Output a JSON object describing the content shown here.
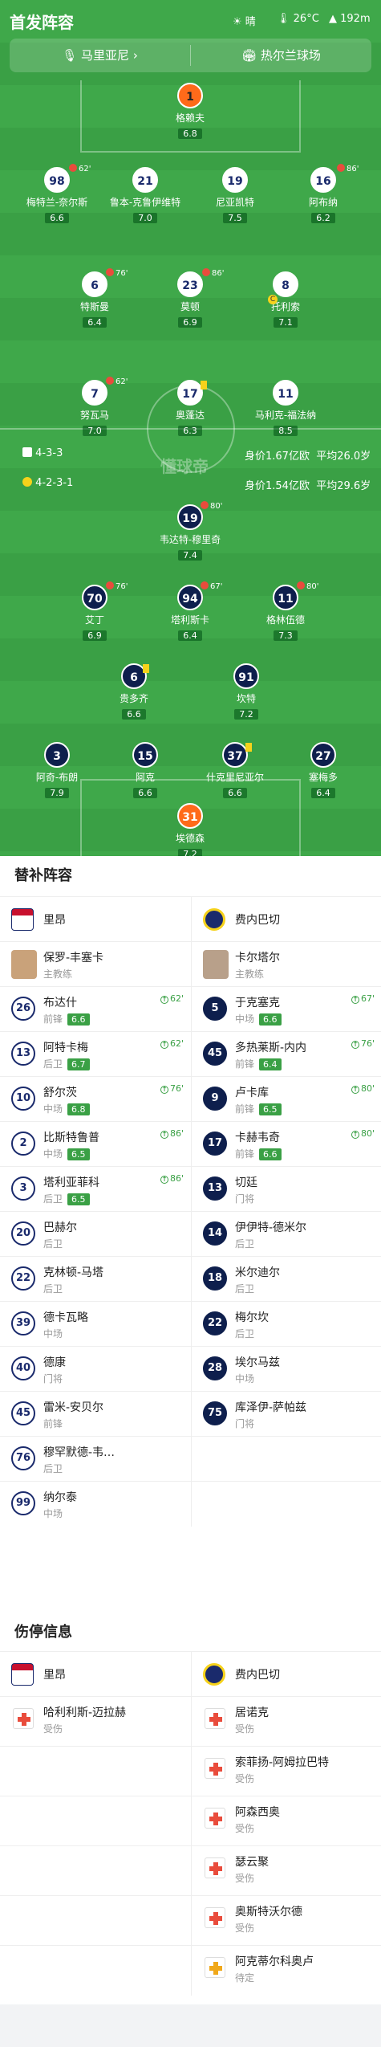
{
  "header": {
    "title": "首发阵容",
    "weather": "晴",
    "temp": "26°C",
    "altitude": "192m"
  },
  "venue": {
    "referee": "马里亚尼",
    "stadium": "热尔兰球场"
  },
  "home": {
    "formation": "4-3-3",
    "value": "身价1.67亿欧",
    "age": "平均26.0岁",
    "players": [
      {
        "num": "1",
        "name": "格赖夫",
        "rating": "6.8"
      },
      {
        "num": "98",
        "name": "梅特兰-奈尔斯",
        "rating": "6.6",
        "sub": "62'"
      },
      {
        "num": "21",
        "name": "鲁本-克鲁伊维特",
        "rating": "7.0"
      },
      {
        "num": "19",
        "name": "尼亚凯特",
        "rating": "7.5"
      },
      {
        "num": "16",
        "name": "阿布纳",
        "rating": "6.2",
        "sub": "86'"
      },
      {
        "num": "6",
        "name": "特斯曼",
        "rating": "6.4",
        "sub": "76'"
      },
      {
        "num": "23",
        "name": "莫顿",
        "rating": "6.9",
        "sub": "86'"
      },
      {
        "num": "8",
        "name": "托利索",
        "rating": "7.1"
      },
      {
        "num": "7",
        "name": "努瓦马",
        "rating": "7.0",
        "sub": "62'"
      },
      {
        "num": "17",
        "name": "奥蓬达",
        "rating": "6.3"
      },
      {
        "num": "11",
        "name": "马利克-福法纳",
        "rating": "8.5"
      }
    ]
  },
  "away": {
    "formation": "4-2-3-1",
    "value": "身价1.54亿欧",
    "age": "平均29.6岁",
    "players": [
      {
        "num": "19",
        "name": "韦达特-穆里奇",
        "rating": "7.4",
        "sub": "80'"
      },
      {
        "num": "70",
        "name": "艾丁",
        "rating": "6.9",
        "sub": "76'"
      },
      {
        "num": "94",
        "name": "塔利斯卡",
        "rating": "6.4",
        "sub": "67'"
      },
      {
        "num": "11",
        "name": "格林伍德",
        "rating": "7.3",
        "sub": "80'"
      },
      {
        "num": "6",
        "name": "贵多齐",
        "rating": "6.6"
      },
      {
        "num": "91",
        "name": "坎特",
        "rating": "7.2"
      },
      {
        "num": "3",
        "name": "阿奇-布朗",
        "rating": "7.9"
      },
      {
        "num": "15",
        "name": "阿克",
        "rating": "6.6"
      },
      {
        "num": "37",
        "name": "什克里尼亚尔",
        "rating": "6.6"
      },
      {
        "num": "27",
        "name": "塞梅多",
        "rating": "6.4"
      },
      {
        "num": "31",
        "name": "埃德森",
        "rating": "7.2"
      }
    ]
  },
  "watermark": "懂球帝",
  "subs": {
    "title": "替补阵容",
    "home_team": "里昂",
    "away_team": "费内巴切",
    "coach_role": "主教练",
    "home_coach": "保罗-丰塞卡",
    "away_coach": "卡尔塔尔",
    "home_list": [
      {
        "num": "26",
        "name": "布达什",
        "pos": "前锋",
        "rating": "6.6",
        "min": "62'"
      },
      {
        "num": "13",
        "name": "阿特卡梅",
        "pos": "后卫",
        "rating": "6.7",
        "min": "62'"
      },
      {
        "num": "10",
        "name": "舒尔茨",
        "pos": "中场",
        "rating": "6.8",
        "min": "76'"
      },
      {
        "num": "2",
        "name": "比斯特鲁普",
        "pos": "中场",
        "rating": "6.5",
        "min": "86'"
      },
      {
        "num": "3",
        "name": "塔利亚菲科",
        "pos": "后卫",
        "rating": "6.5",
        "min": "86'"
      },
      {
        "num": "20",
        "name": "巴赫尔",
        "pos": "后卫"
      },
      {
        "num": "22",
        "name": "克林顿-马塔",
        "pos": "后卫"
      },
      {
        "num": "39",
        "name": "德卡瓦略",
        "pos": "中场"
      },
      {
        "num": "40",
        "name": "德康",
        "pos": "门将"
      },
      {
        "num": "45",
        "name": "雷米-安贝尔",
        "pos": "前锋"
      },
      {
        "num": "76",
        "name": "穆罕默德-韦…",
        "pos": "后卫"
      },
      {
        "num": "99",
        "name": "纳尔泰",
        "pos": "中场"
      }
    ],
    "away_list": [
      {
        "num": "5",
        "name": "于克塞克",
        "pos": "中场",
        "rating": "6.6",
        "min": "67'"
      },
      {
        "num": "45",
        "name": "多热莱斯-内内",
        "pos": "前锋",
        "rating": "6.4",
        "min": "76'"
      },
      {
        "num": "9",
        "name": "卢卡库",
        "pos": "前锋",
        "rating": "6.5",
        "min": "80'"
      },
      {
        "num": "17",
        "name": "卡赫韦奇",
        "pos": "前锋",
        "rating": "6.6",
        "min": "80'"
      },
      {
        "num": "13",
        "name": "切廷",
        "pos": "门将"
      },
      {
        "num": "14",
        "name": "伊伊特-德米尔",
        "pos": "后卫"
      },
      {
        "num": "18",
        "name": "米尔迪尔",
        "pos": "后卫"
      },
      {
        "num": "22",
        "name": "梅尔坎",
        "pos": "后卫"
      },
      {
        "num": "28",
        "name": "埃尔马兹",
        "pos": "中场"
      },
      {
        "num": "75",
        "name": "库泽伊-萨帕兹",
        "pos": "门将"
      }
    ]
  },
  "injury": {
    "title": "伤停信息",
    "home_list": [
      {
        "name": "哈利利斯-迈拉赫",
        "status": "受伤"
      }
    ],
    "away_list": [
      {
        "name": "居诺克",
        "status": "受伤"
      },
      {
        "name": "索菲扬-阿姆拉巴特",
        "status": "受伤"
      },
      {
        "name": "阿森西奥",
        "status": "受伤"
      },
      {
        "name": "瑟云聚",
        "status": "受伤"
      },
      {
        "name": "奥斯特沃尔德",
        "status": "受伤"
      },
      {
        "name": "阿克蒂尔科奥卢",
        "status": "待定"
      }
    ]
  }
}
